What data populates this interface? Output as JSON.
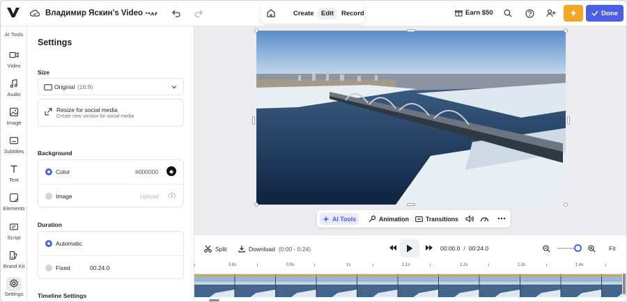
{
  "header": {
    "project_title": "Владимир Яскин's Video - ...",
    "center_tabs": [
      "Create",
      "Edit",
      "Record"
    ],
    "active_tab": "Edit",
    "earn_label": "Earn $50",
    "done_label": "Done"
  },
  "rail": {
    "items": [
      {
        "label": "AI Tools",
        "icon": "sparkle-icon"
      },
      {
        "label": "Video",
        "icon": "video-icon"
      },
      {
        "label": "Audio",
        "icon": "music-note-icon"
      },
      {
        "label": "Image",
        "icon": "image-icon"
      },
      {
        "label": "Subtitles",
        "icon": "subtitles-icon"
      },
      {
        "label": "Text",
        "icon": "text-icon"
      },
      {
        "label": "Elements",
        "icon": "elements-icon"
      },
      {
        "label": "Script",
        "icon": "script-icon"
      },
      {
        "label": "Brand Kit",
        "icon": "brand-kit-icon"
      },
      {
        "label": "Settings",
        "icon": "gear-icon"
      }
    ],
    "active": "Settings"
  },
  "settings": {
    "title": "Settings",
    "size_label": "Size",
    "size_value": "Original",
    "size_ratio": "(16:9)",
    "resize_title": "Resize for social media",
    "resize_desc": "Create new version for social media",
    "background_label": "Background",
    "color_label": "Color",
    "color_value": "#000000",
    "image_label": "Image",
    "upload_label": "Upload",
    "duration_label": "Duration",
    "automatic_label": "Automatic",
    "fixed_label": "Fixed",
    "fixed_value": "00:24.0",
    "timeline_settings_label": "Timeline Settings"
  },
  "canvas_toolbar": {
    "ai_tools": "AI Tools",
    "animation": "Animation",
    "transitions": "Transitions"
  },
  "timeline": {
    "split_label": "Split",
    "download_label": "Download",
    "download_range": "(0:00 - 0:24)",
    "current_time": "00:00.0",
    "separator": "/",
    "total_time": "00:24.0",
    "fit_label": "Fit",
    "ruler_labels": [
      "0.8s",
      "0.9s",
      "1s",
      "1.1s",
      "1.2s",
      "1.3s",
      "1.4s"
    ]
  },
  "colors": {
    "accent": "#4b5fe6",
    "bolt": "#f5a623",
    "track_border": "#e6a317"
  }
}
